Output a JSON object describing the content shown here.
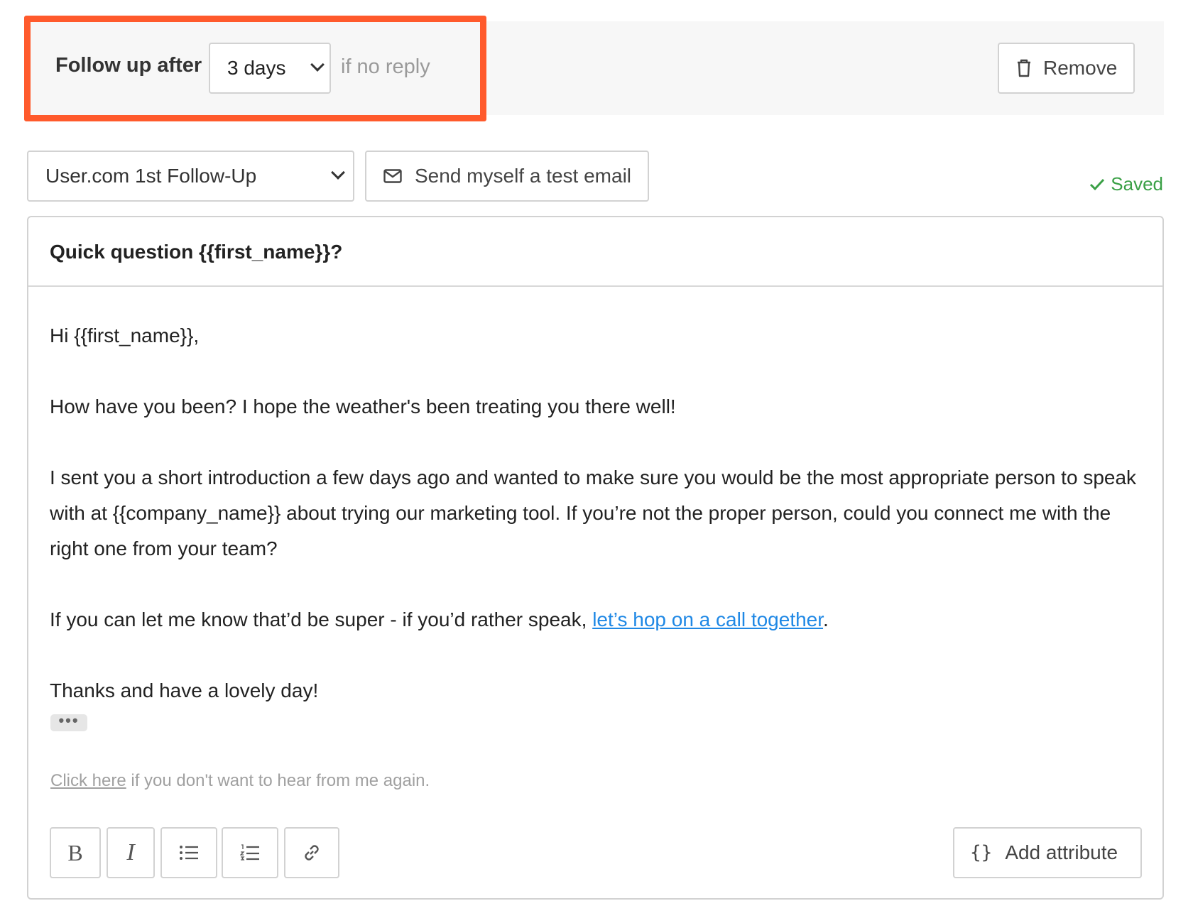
{
  "followup": {
    "label": "Follow up after",
    "delay_value": "3 days",
    "condition": "if no reply",
    "remove_label": "Remove"
  },
  "template": {
    "selected": "User.com 1st Follow-Up",
    "test_email_label": "Send myself a test email",
    "status": "Saved"
  },
  "email": {
    "subject": "Quick question {{first_name}}?",
    "greeting": "Hi {{first_name}},",
    "p1": "How have you been? I hope the weather's been treating you there well!",
    "p2": "I sent you a short introduction a few days ago and wanted to make sure you would be the most appropriate person to speak with at {{company_name}} about trying our marketing tool. If you’re not the proper person, could you connect me with the right one from your team?",
    "p3_before": "If you can let me know that’d be super - if you’d rather speak, ",
    "p3_link": "let’s hop on a call together",
    "p3_after": ".",
    "p4": "Thanks and have a lovely day!",
    "ellipsis": "•••",
    "unsubscribe_link": "Click here",
    "unsubscribe_text": " if you don't want to hear from me again."
  },
  "toolbar": {
    "bold": "B",
    "italic": "I",
    "add_attribute_label": "Add attribute",
    "braces": "{}"
  },
  "colors": {
    "highlight": "#ff5a2c",
    "link": "#1f88e5",
    "saved": "#3aa046"
  }
}
